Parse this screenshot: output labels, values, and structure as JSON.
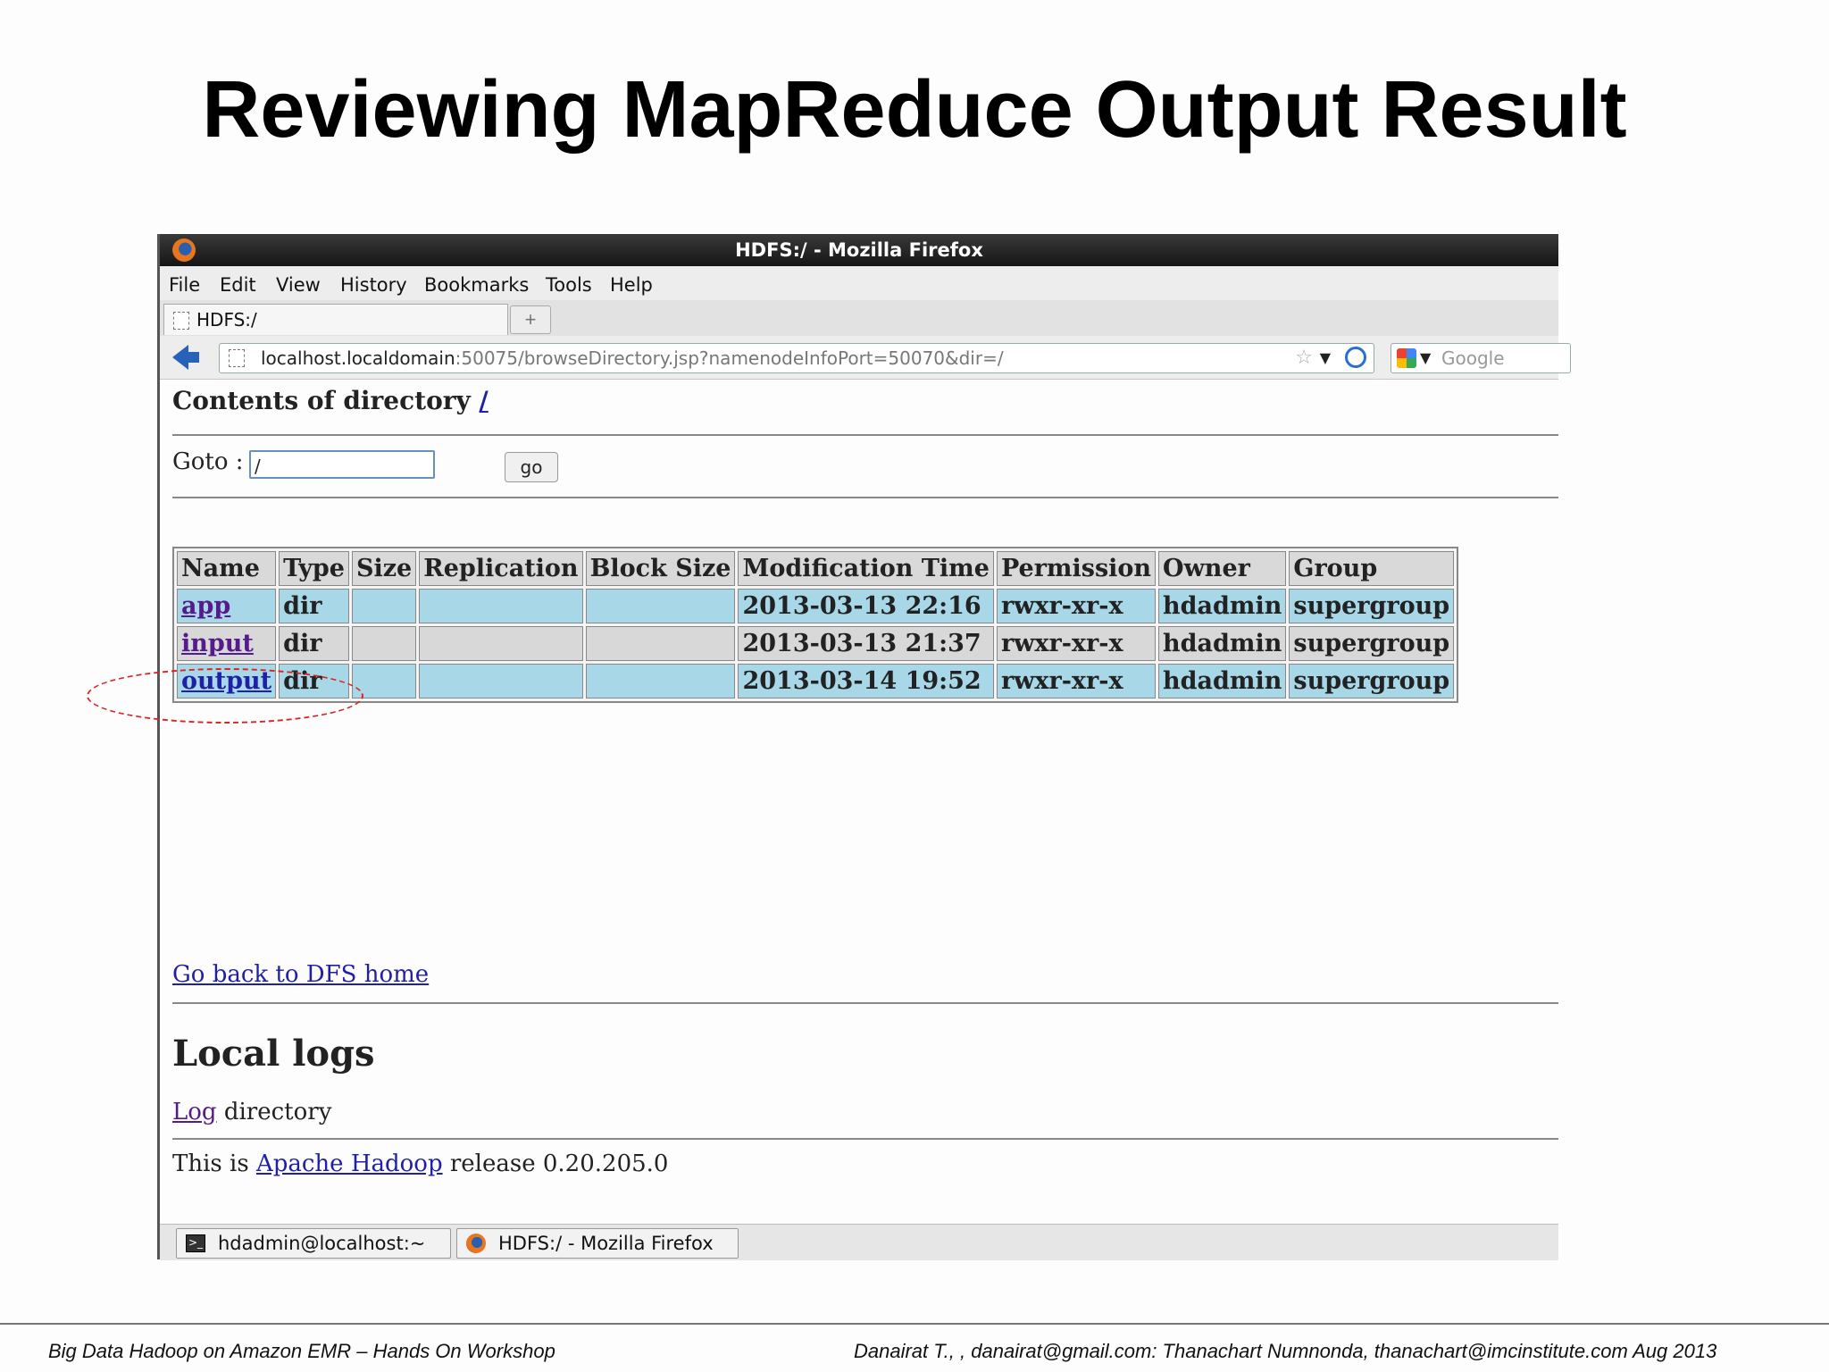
{
  "slide": {
    "title": "Reviewing MapReduce Output Result",
    "footer_left": "Big Data Hadoop on Amazon EMR – Hands On Workshop",
    "footer_right": "Danairat T., , danairat@gmail.com:  Thanachart Numnonda,  thanachart@imcinstitute.com   Aug 2013"
  },
  "window": {
    "title": "HDFS:/ - Mozilla Firefox",
    "menu": [
      "File",
      "Edit",
      "View",
      "History",
      "Bookmarks",
      "Tools",
      "Help"
    ],
    "tab_label": "HDFS:/",
    "new_tab_icon": "+",
    "url_host": "localhost.localdomain",
    "url_rest": ":50075/browseDirectory.jsp?namenodeInfoPort=50070&dir=/",
    "search_placeholder": "Google"
  },
  "page": {
    "heading": "Contents of directory ",
    "heading_link": "/",
    "goto_label": "Goto : ",
    "goto_value": "/",
    "go_button": "go",
    "table": {
      "headers": [
        "Name",
        "Type",
        "Size",
        "Replication",
        "Block Size",
        "Modification Time",
        "Permission",
        "Owner",
        "Group"
      ],
      "rows": [
        {
          "name": "app",
          "type": "dir",
          "size": "",
          "replication": "",
          "block_size": "",
          "mtime": "2013-03-13 22:16",
          "permission": "rwxr-xr-x",
          "owner": "hdadmin",
          "group": "supergroup"
        },
        {
          "name": "input",
          "type": "dir",
          "size": "",
          "replication": "",
          "block_size": "",
          "mtime": "2013-03-13 21:37",
          "permission": "rwxr-xr-x",
          "owner": "hdadmin",
          "group": "supergroup"
        },
        {
          "name": "output",
          "type": "dir",
          "size": "",
          "replication": "",
          "block_size": "",
          "mtime": "2013-03-14 19:52",
          "permission": "rwxr-xr-x",
          "owner": "hdadmin",
          "group": "supergroup"
        }
      ]
    },
    "back_link": "Go back to DFS home",
    "local_logs_heading": "Local logs",
    "log_link": "Log",
    "log_suffix": " directory",
    "release_prefix": "This is ",
    "release_link": "Apache Hadoop",
    "release_suffix": " release 0.20.205.0"
  },
  "taskbar": {
    "items": [
      "hdadmin@localhost:~",
      "HDFS:/ - Mozilla Firefox"
    ]
  },
  "colors": {
    "highlight_row": "#a8d8e8",
    "annotation": "#dd2222"
  }
}
